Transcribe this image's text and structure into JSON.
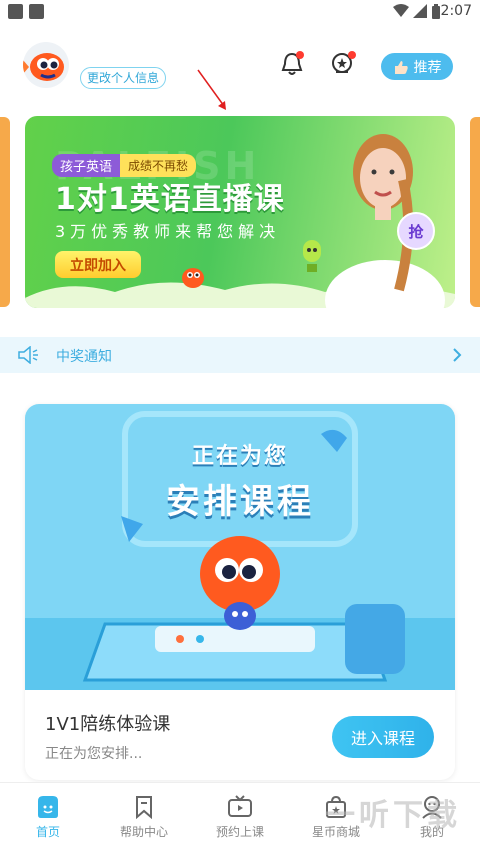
{
  "status_bar": {
    "time": "2:07"
  },
  "header": {
    "edit_profile": "更改个人信息",
    "recommend_label": "推荐"
  },
  "banner": {
    "tag_kids": "孩子英语",
    "tag_grade": "成绩不再愁",
    "title": "1对1英语直播课",
    "subtitle": "3万优秀教师来帮您解决",
    "join_button": "立即加入",
    "grab_badge": "抢",
    "watermark": "PALFISH"
  },
  "notice": {
    "text": "中奖通知"
  },
  "course_card": {
    "illus_line1": "正在为您",
    "illus_line2": "安排课程",
    "title": "1V1陪练体验课",
    "subtitle": "正在为您安排...",
    "enter_button": "进入课程"
  },
  "bottom_nav": {
    "items": [
      {
        "label": "首页",
        "icon": "home-icon",
        "active": true
      },
      {
        "label": "帮助中心",
        "icon": "bookmark-icon",
        "active": false
      },
      {
        "label": "预约上课",
        "icon": "tv-icon",
        "active": false
      },
      {
        "label": "星币商城",
        "icon": "shop-bag-icon",
        "active": false
      },
      {
        "label": "我的",
        "icon": "profile-icon",
        "active": false
      }
    ]
  },
  "watermark_text": "一听下载",
  "colors": {
    "accent": "#36b6ea",
    "banner_green": "#4cc85a",
    "notice_bg": "#eaf7fd",
    "red_dot": "#ff3b30"
  }
}
